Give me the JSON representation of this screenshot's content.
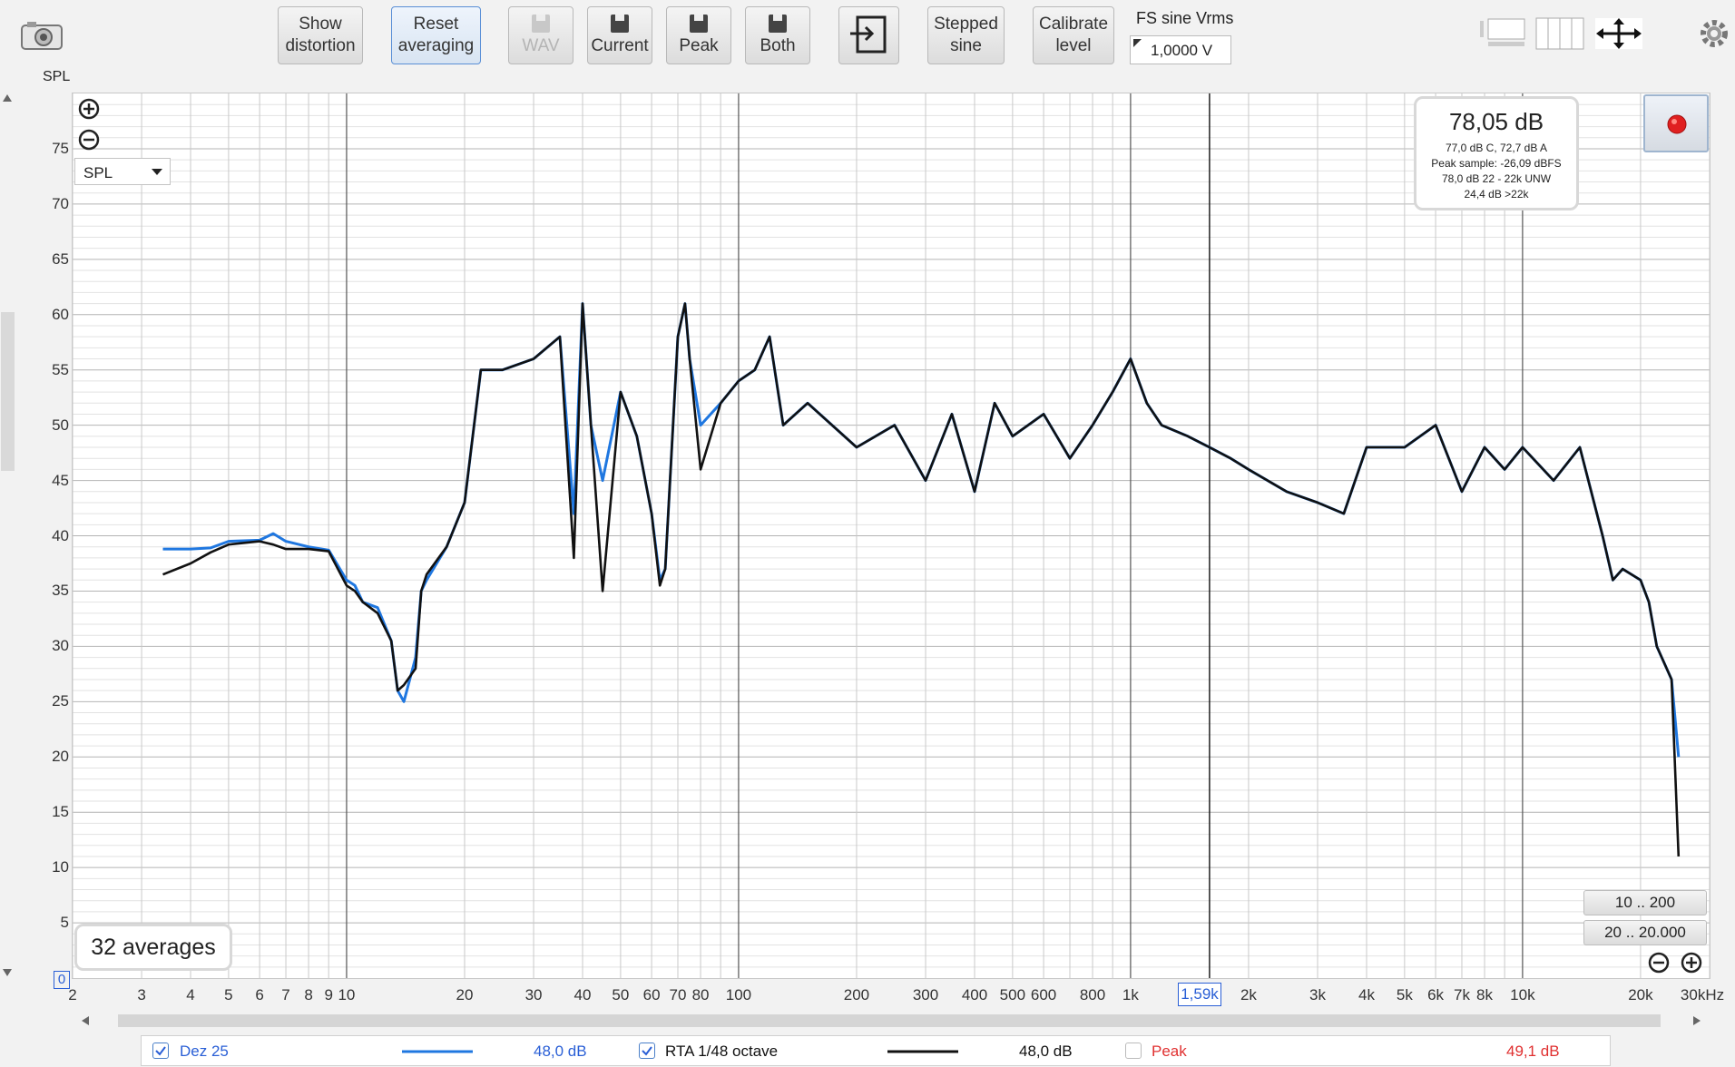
{
  "toolbar": {
    "show_distortion": [
      "Show",
      "distortion"
    ],
    "reset_averaging": [
      "Reset",
      "averaging"
    ],
    "wav": "WAV",
    "current": "Current",
    "peak": "Peak",
    "both": "Both",
    "stepped_sine": [
      "Stepped",
      "sine"
    ],
    "calibrate_level": [
      "Calibrate",
      "level"
    ],
    "fs_label": "FS sine Vrms",
    "fs_value": "1,0000 V"
  },
  "graph": {
    "y_title": "SPL",
    "mode_select": "SPL",
    "cursor_freq": "1,59k",
    "y_zero": "0",
    "averages": "32 averages",
    "zoom_presets": [
      "10 .. 200",
      "20 .. 20.000"
    ]
  },
  "level_box": {
    "main": "78,05 dB",
    "lines": [
      "77,0 dB C, 72,7 dB A",
      "Peak sample: -26,09 dBFS",
      "78,0 dB 22 - 22k UNW",
      "24,4 dB >22k"
    ]
  },
  "legend": {
    "dez": {
      "label": "Dez 25",
      "value": "48,0 dB",
      "checked": true,
      "color": "#1f77e0"
    },
    "rta": {
      "label": "RTA 1/48 octave",
      "value": "48,0 dB",
      "checked": true,
      "color": "#111111"
    },
    "peak": {
      "label": "Peak",
      "value": "49,1 dB",
      "checked": false,
      "color": "#e03030"
    }
  },
  "chart_data": {
    "type": "line",
    "x_scale": "log",
    "x_unit": "kHz",
    "xlim": [
      2,
      30000
    ],
    "ylim": [
      0,
      80
    ],
    "y_ticks": [
      5,
      10,
      15,
      20,
      25,
      30,
      35,
      40,
      45,
      50,
      55,
      60,
      65,
      70,
      75
    ],
    "x_tick_labels": [
      "2",
      "3",
      "4",
      "5",
      "6",
      "7",
      "8",
      "9",
      "10",
      "20",
      "30",
      "40",
      "50",
      "60",
      "70",
      "80",
      "100",
      "200",
      "300",
      "400",
      "500",
      "600",
      "800",
      "1k",
      "2k",
      "3k",
      "4k",
      "5k",
      "6k",
      "7k",
      "8k",
      "10k",
      "20k",
      "30kHz"
    ],
    "x_tick_values": [
      2,
      3,
      4,
      5,
      6,
      7,
      8,
      9,
      10,
      20,
      30,
      40,
      50,
      60,
      70,
      80,
      100,
      200,
      300,
      400,
      500,
      600,
      800,
      1000,
      2000,
      3000,
      4000,
      5000,
      6000,
      7000,
      8000,
      10000,
      20000,
      30000
    ],
    "cursor_x": 1590,
    "series": [
      {
        "name": "Dez 25",
        "color": "#1f77e0",
        "x": [
          3.4,
          4,
          4.5,
          5,
          6,
          6.5,
          7,
          8,
          9,
          10,
          10.5,
          11,
          12,
          13,
          13.5,
          14,
          15,
          15.5,
          16,
          18,
          20,
          22,
          25,
          30,
          35,
          38,
          40,
          42,
          45,
          50,
          55,
          60,
          63,
          65,
          70,
          73,
          75,
          80,
          90,
          100,
          110,
          120,
          130,
          150,
          200,
          250,
          300,
          350,
          400,
          450,
          500,
          600,
          700,
          800,
          900,
          1000,
          1100,
          1200,
          1400,
          1590,
          1800,
          2000,
          2500,
          3000,
          3500,
          4000,
          5000,
          6000,
          7000,
          8000,
          9000,
          10000,
          12000,
          14000,
          16000,
          17000,
          18000,
          20000,
          21000,
          22000,
          24000,
          25000
        ],
        "y": [
          38.8,
          38.8,
          38.9,
          39.5,
          39.6,
          40.2,
          39.5,
          39,
          38.7,
          36,
          35.5,
          34,
          33.5,
          30.5,
          26,
          25,
          29,
          35,
          36,
          39,
          43,
          55,
          55,
          56,
          58,
          42,
          61,
          50,
          45,
          53,
          49,
          42,
          36,
          37,
          58,
          61,
          56,
          50,
          52,
          54,
          55,
          58,
          50,
          52,
          48,
          50,
          45,
          51,
          44,
          52,
          49,
          51,
          47,
          50,
          53,
          56,
          52,
          50,
          49,
          48,
          47,
          46,
          44,
          43,
          42,
          48,
          48,
          50,
          44,
          48,
          46,
          48,
          45,
          48,
          40,
          36,
          37,
          36,
          34,
          30,
          27,
          20
        ],
        "points_note": ""
      },
      {
        "name": "RTA 1/48 octave",
        "color": "#111111",
        "x": [
          3.4,
          4,
          4.5,
          5,
          6,
          6.5,
          7,
          8,
          9,
          10,
          10.5,
          11,
          12,
          13,
          13.5,
          14,
          15,
          15.5,
          16,
          18,
          20,
          22,
          25,
          30,
          35,
          38,
          40,
          42,
          45,
          50,
          55,
          60,
          63,
          65,
          70,
          73,
          75,
          80,
          90,
          100,
          110,
          120,
          130,
          150,
          200,
          250,
          300,
          350,
          400,
          450,
          500,
          600,
          700,
          800,
          900,
          1000,
          1100,
          1200,
          1400,
          1590,
          1800,
          2000,
          2500,
          3000,
          3500,
          4000,
          5000,
          6000,
          7000,
          8000,
          9000,
          10000,
          12000,
          14000,
          16000,
          17000,
          18000,
          20000,
          21000,
          22000,
          24000,
          25000
        ],
        "y": [
          36.5,
          37.5,
          38.5,
          39.2,
          39.5,
          39.2,
          38.8,
          38.8,
          38.6,
          35.5,
          35,
          34,
          33,
          30.5,
          26,
          26.5,
          28,
          35,
          36.5,
          39,
          43,
          55,
          55,
          56,
          58,
          38,
          61,
          50,
          35,
          53,
          49,
          42,
          35.5,
          37,
          58,
          61,
          56,
          46,
          52,
          54,
          55,
          58,
          50,
          52,
          48,
          50,
          45,
          51,
          44,
          52,
          49,
          51,
          47,
          50,
          53,
          56,
          52,
          50,
          49,
          48,
          47,
          46,
          44,
          43,
          42,
          48,
          48,
          50,
          44,
          48,
          46,
          48,
          45,
          48,
          40,
          36,
          37,
          36,
          34,
          30,
          27,
          11
        ]
      }
    ]
  }
}
